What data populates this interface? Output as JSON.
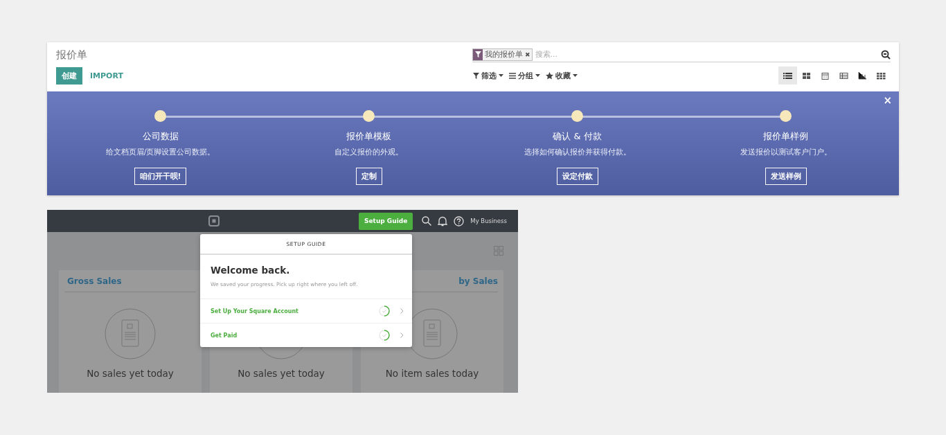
{
  "quotes_panel": {
    "title": "报价单",
    "create_button": "创建",
    "import_button": "IMPORT",
    "search": {
      "facet": "我的报价单",
      "facet_remove": "✖",
      "placeholder": "搜索..."
    },
    "menus": [
      {
        "kind": "filter",
        "label": "筛选"
      },
      {
        "kind": "group",
        "label": "分组"
      },
      {
        "kind": "favorite",
        "label": "收藏"
      }
    ],
    "views": [
      {
        "kind": "list",
        "selected": true
      },
      {
        "kind": "kanban",
        "selected": false
      },
      {
        "kind": "calendar",
        "selected": false
      },
      {
        "kind": "pivot",
        "selected": false
      },
      {
        "kind": "graph",
        "selected": false
      },
      {
        "kind": "grid",
        "selected": false
      }
    ],
    "banner": {
      "close": "×",
      "steps": [
        {
          "title": "公司数据",
          "description": "给文档页眉/页脚设置公司数据。",
          "button": "咱们开干呗!"
        },
        {
          "title": "报价单模板",
          "description": "自定义报价的外观。",
          "button": "定制"
        },
        {
          "title": "确认 & 付款",
          "description": "选择如何确认报价并获得付款。",
          "button": "设定付款"
        },
        {
          "title": "报价单样例",
          "description": "发送报价以测试客户门户。",
          "button": "发送样例"
        }
      ]
    }
  },
  "dashboard_panel": {
    "setup_button": "Setup Guide",
    "account": "My Business",
    "cards": [
      {
        "title": "Gross Sales",
        "empty_text": "No sales yet today"
      },
      {
        "empty_text": "No sales yet today"
      },
      {
        "title": "by Sales",
        "empty_text": "No item sales today"
      }
    ],
    "setup_guide": {
      "header": "SETUP GUIDE",
      "heading": "Welcome back.",
      "subtext": "We saved your progress. Pick up right where you left off.",
      "items": [
        {
          "label": "Set Up Your Square Account"
        },
        {
          "label": "Get Paid"
        }
      ]
    }
  }
}
